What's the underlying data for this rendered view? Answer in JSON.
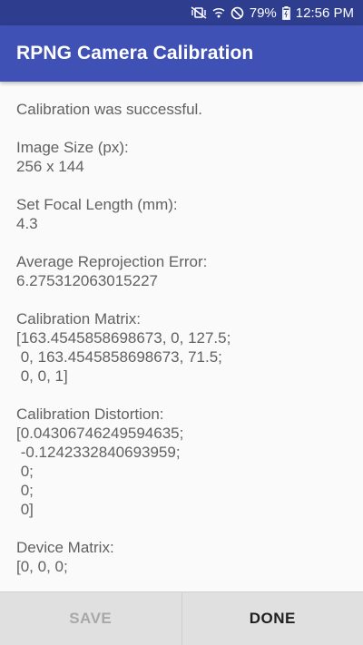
{
  "status_bar": {
    "battery": "79%",
    "time": "12:56 PM",
    "icons": [
      "vibrate-mute-icon",
      "wifi-icon",
      "do-not-disturb-icon",
      "battery-charging-icon"
    ]
  },
  "app_bar": {
    "title": "RPNG Camera Calibration",
    "color": "#3f51b5"
  },
  "content": {
    "message": "Calibration was successful.",
    "image_size": {
      "label": "Image Size (px):",
      "value": "256 x 144"
    },
    "focal_length": {
      "label": "Set Focal Length (mm):",
      "value": "4.3"
    },
    "reprojection_error": {
      "label": "Average Reprojection Error:",
      "value": "6.275312063015227"
    },
    "calibration_matrix": {
      "label": "Calibration Matrix:",
      "lines": [
        "[163.4545858698673, 0, 127.5;",
        " 0, 163.4545858698673, 71.5;",
        " 0, 0, 1]"
      ]
    },
    "calibration_distortion": {
      "label": "Calibration Distortion:",
      "lines": [
        "[0.04306746249594635;",
        " -0.1242332840693959;",
        " 0;",
        " 0;",
        " 0]"
      ]
    },
    "device_matrix": {
      "label": "Device Matrix:",
      "lines": [
        "[0, 0, 0;"
      ]
    }
  },
  "buttons": {
    "save_label": "SAVE",
    "done_label": "DONE"
  }
}
